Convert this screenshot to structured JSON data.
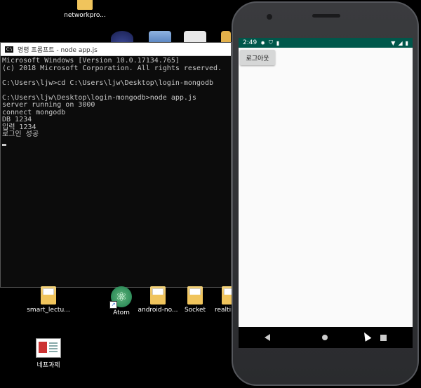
{
  "desktop": {
    "top_icon_label": "networkpro...",
    "icons": [
      {
        "label": "smart_lectu...",
        "type": "folder"
      },
      {
        "label": "Atom",
        "type": "atom"
      },
      {
        "label": "android-no...",
        "type": "folder"
      },
      {
        "label": "Socket",
        "type": "folder"
      },
      {
        "label": "realtim",
        "type": "folder"
      },
      {
        "label": "네프과제",
        "type": "document"
      }
    ]
  },
  "cmd": {
    "title": "명령 프롬프트 - node  app.js",
    "lines": [
      "Microsoft Windows [Version 10.0.17134.765]",
      "(c) 2018 Microsoft Corporation. All rights reserved.",
      "",
      "C:\\Users\\ljw>cd C:\\Users\\ljw\\Desktop\\login-mongodb",
      "",
      "C:\\Users\\ljw\\Desktop\\login-mongodb>node app.js",
      "server running on 3000",
      "connect mongodb",
      "DB 1234",
      "입력 1234",
      "로그인 성공"
    ]
  },
  "phone": {
    "time": "2:49",
    "logout_label": "로그아웃"
  }
}
